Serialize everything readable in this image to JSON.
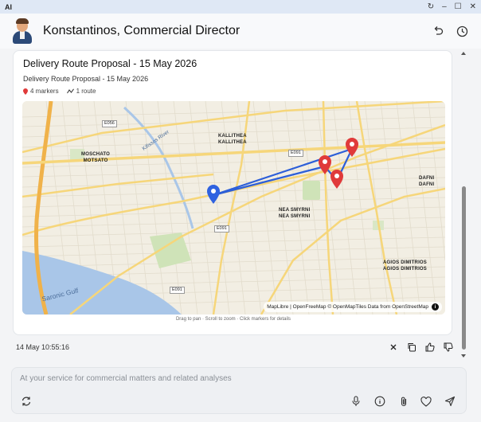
{
  "titlebar": {
    "app_name": "AI"
  },
  "header": {
    "title": "Konstantinos, Commercial Director"
  },
  "card": {
    "title": "Delivery Route Proposal - 15 May 2026",
    "subtitle": "Delivery Route Proposal - 15 May 2026",
    "markers_count": "4 markers",
    "routes_count": "1 route"
  },
  "map": {
    "places": {
      "kallithea": "KALLITHEA",
      "kallithea_gr": "KALLITHEA",
      "moschato": "MOSCHATO",
      "moschato_gr": "MOTSATO",
      "nea_smyrni": "NEA SMYRNI",
      "nea_smyrni_gr": "NEA SMYRNI",
      "dafni": "DAFNI",
      "dafni_gr": "DAFNI",
      "agios_dimitrios": "AGIOS DIMITRIOS",
      "agios_dimitrios_gr": "AGIOS DIMITRIOS"
    },
    "roads": {
      "e056": "E056",
      "e091_a": "E091",
      "e091_b": "E091",
      "e091_c": "E091"
    },
    "water": {
      "gulf": "Saronic Gulf",
      "river": "Kifissos River"
    },
    "attribution": "MapLibre | OpenFreeMap © OpenMapTiles Data from OpenStreetMap",
    "attribution_info": "i",
    "hint": "Drag to pan · Scroll to zoom · Click markers for details",
    "colors": {
      "route": "#2d5fd8",
      "start_marker": "#2f62e0",
      "stop_marker": "#e03a3a"
    }
  },
  "message": {
    "timestamp": "14 May 10:55:16"
  },
  "composer": {
    "placeholder": "At your service for commercial matters and related analyses"
  }
}
